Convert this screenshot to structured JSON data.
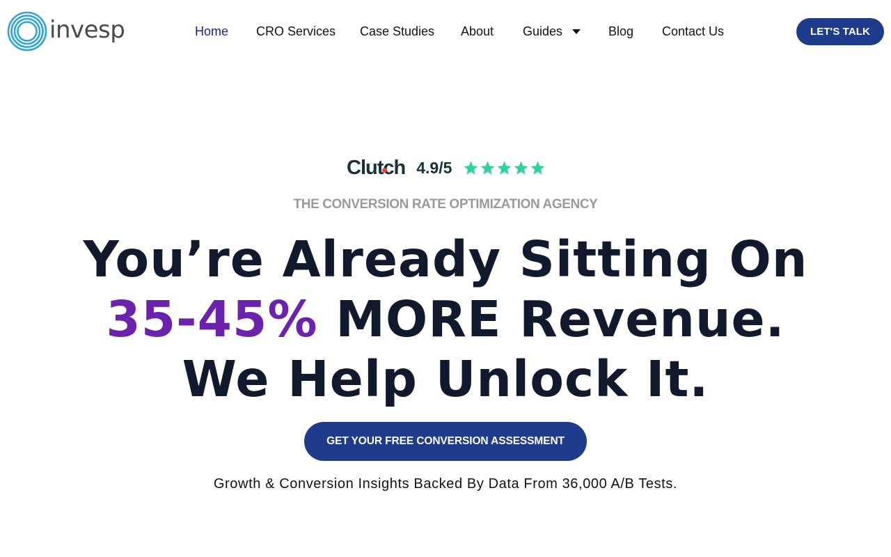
{
  "brand": {
    "logo_text": "invesp",
    "logo_icon": "spiral-circle-icon",
    "logo_color": "#2ea3dd"
  },
  "nav": {
    "items": [
      {
        "label": "Home",
        "active": true
      },
      {
        "label": "CRO Services"
      },
      {
        "label": "Case Studies"
      },
      {
        "label": "About"
      },
      {
        "label": "Guides",
        "icon": "caret-down-icon"
      },
      {
        "label": "Blog"
      },
      {
        "label": "Contact Us"
      }
    ],
    "cta_label": "LET'S TALK"
  },
  "rating": {
    "provider_prefix": "Clut",
    "provider_suffix": "ch",
    "score": "4.9/5",
    "value": 4.9,
    "max": 5,
    "star_icon": "star-icon",
    "star_color": "#2fd39e"
  },
  "hero": {
    "eyebrow": "THE CONVERSION RATE OPTIMIZATION AGENCY",
    "line1": "You’re Already Sitting On",
    "line2_accent": "35-45%",
    "line2_rest": " MORE Revenue.",
    "line3": "We Help Unlock It.",
    "cta_label": "GET YOUR FREE CONVERSION ASSESSMENT",
    "subline": "Growth & Conversion Insights Backed By Data From 36,000 A/B Tests."
  },
  "colors": {
    "primary_button": "#1f3b8c",
    "accent_text": "#6b23ad",
    "active_nav": "#1b1f8a",
    "heading": "#111a2c"
  }
}
